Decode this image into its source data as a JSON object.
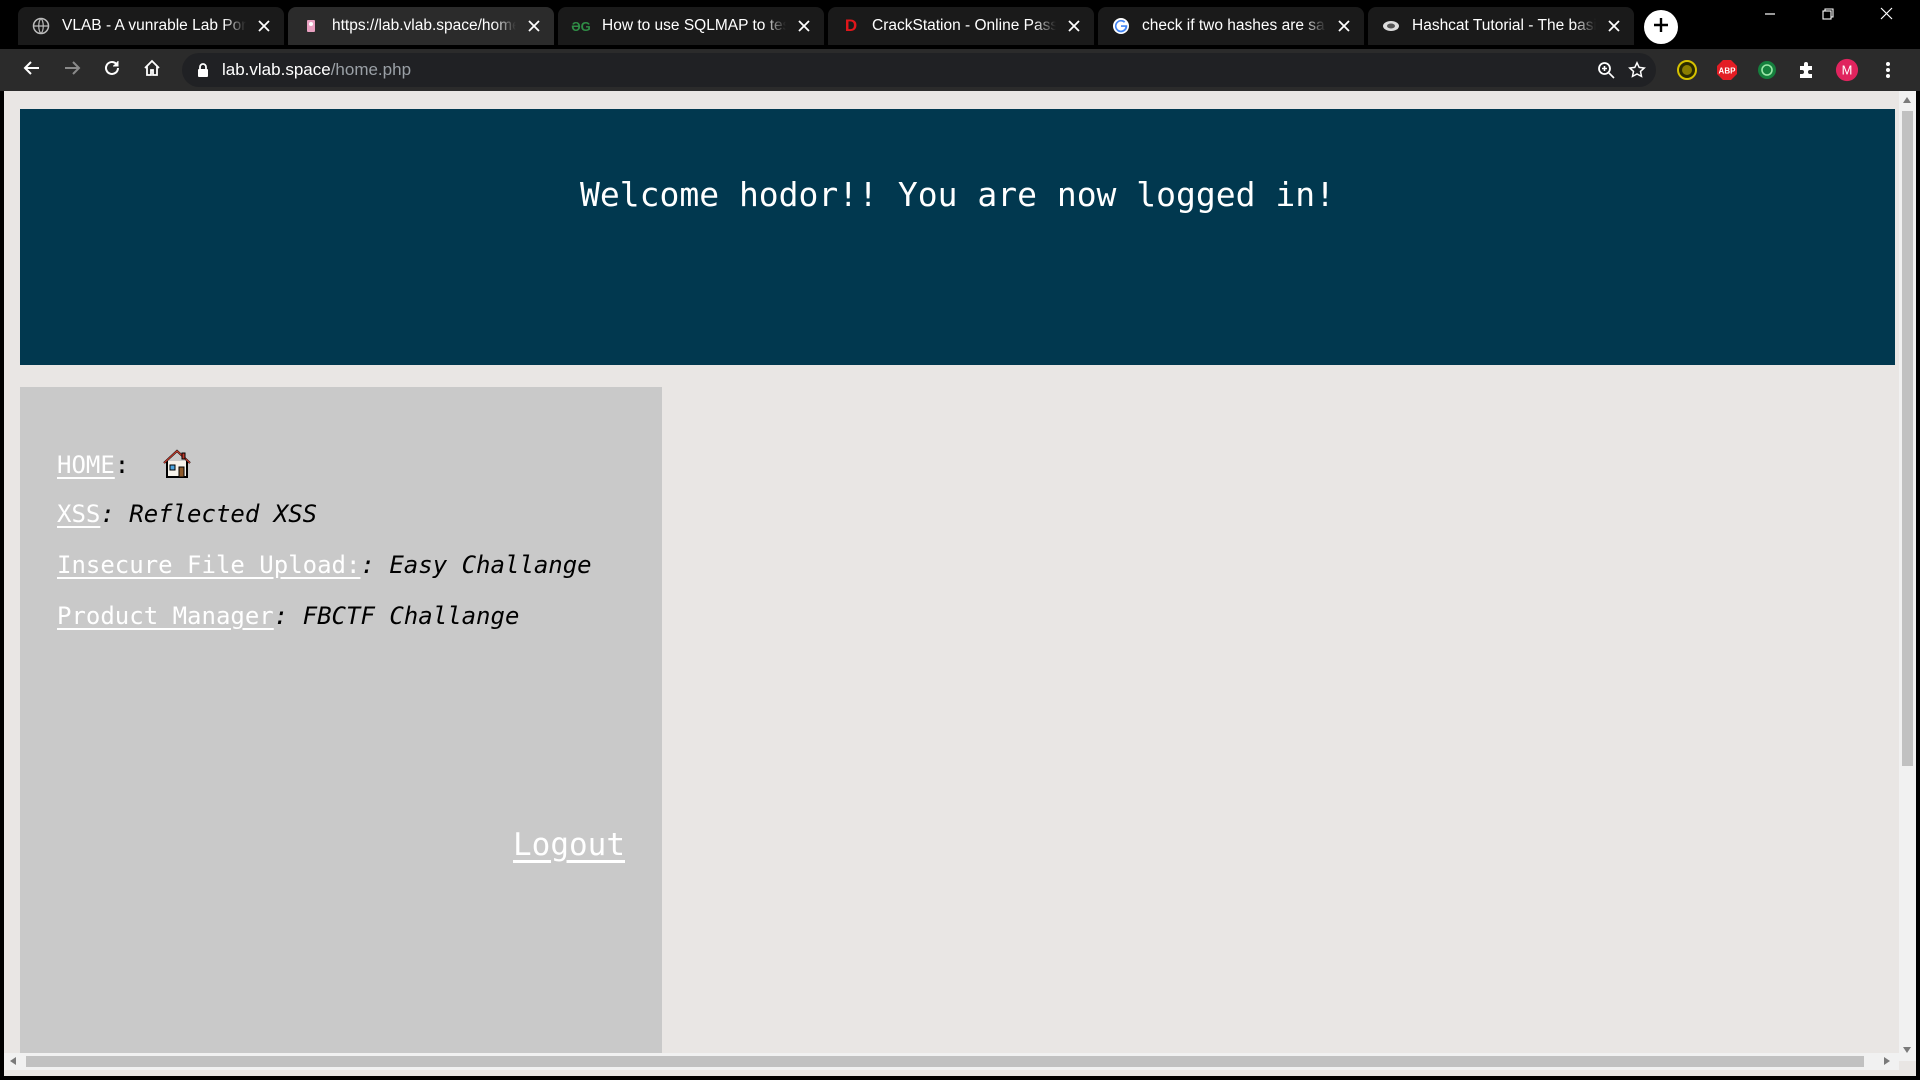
{
  "browser": {
    "tabs": [
      {
        "title": "VLAB - A vunrable Lab Portal",
        "icon": "globe-icon",
        "active": false
      },
      {
        "title": "https://lab.vlab.space/home.php",
        "icon": "page-icon",
        "active": true
      },
      {
        "title": "How to use SQLMAP to test a website",
        "icon": "geeksforgeeks-icon",
        "active": false
      },
      {
        "title": "CrackStation - Online Password Hash Cracking",
        "icon": "crackstation-icon",
        "active": false
      },
      {
        "title": "check if two hashes are same",
        "icon": "google-icon",
        "active": false
      },
      {
        "title": "Hashcat Tutorial - The basics",
        "icon": "hashcat-icon",
        "active": false
      }
    ],
    "url_host": "lab.vlab.space",
    "url_path": "/home.php",
    "extensions": [
      "theme-extension-icon",
      "adblock-plus-icon",
      "grammar-extension-icon",
      "extensions-puzzle-icon",
      "profile-avatar-icon"
    ],
    "extension_labels": {
      "adblock": "ABP",
      "avatar": "M"
    },
    "colors": {
      "avatar": "#e0245e",
      "adblock": "#e31d24"
    }
  },
  "page": {
    "banner_title": "Welcome hodor!! You are now logged in!",
    "nav": [
      {
        "link": "HOME",
        "sep": ":",
        "desc": "",
        "icon": "house-icon"
      },
      {
        "link": "XSS",
        "sep": ":",
        "desc": " Reflected XSS"
      },
      {
        "link": "Insecure File Upload:",
        "sep": ":",
        "desc": " Easy Challange"
      },
      {
        "link": "Product Manager",
        "sep": ":",
        "desc": " FBCTF Challange"
      }
    ],
    "logout_label": "Logout",
    "colors": {
      "banner": "#01384f",
      "sidebar": "#c9c9c9",
      "background": "#e9e6e4"
    }
  }
}
